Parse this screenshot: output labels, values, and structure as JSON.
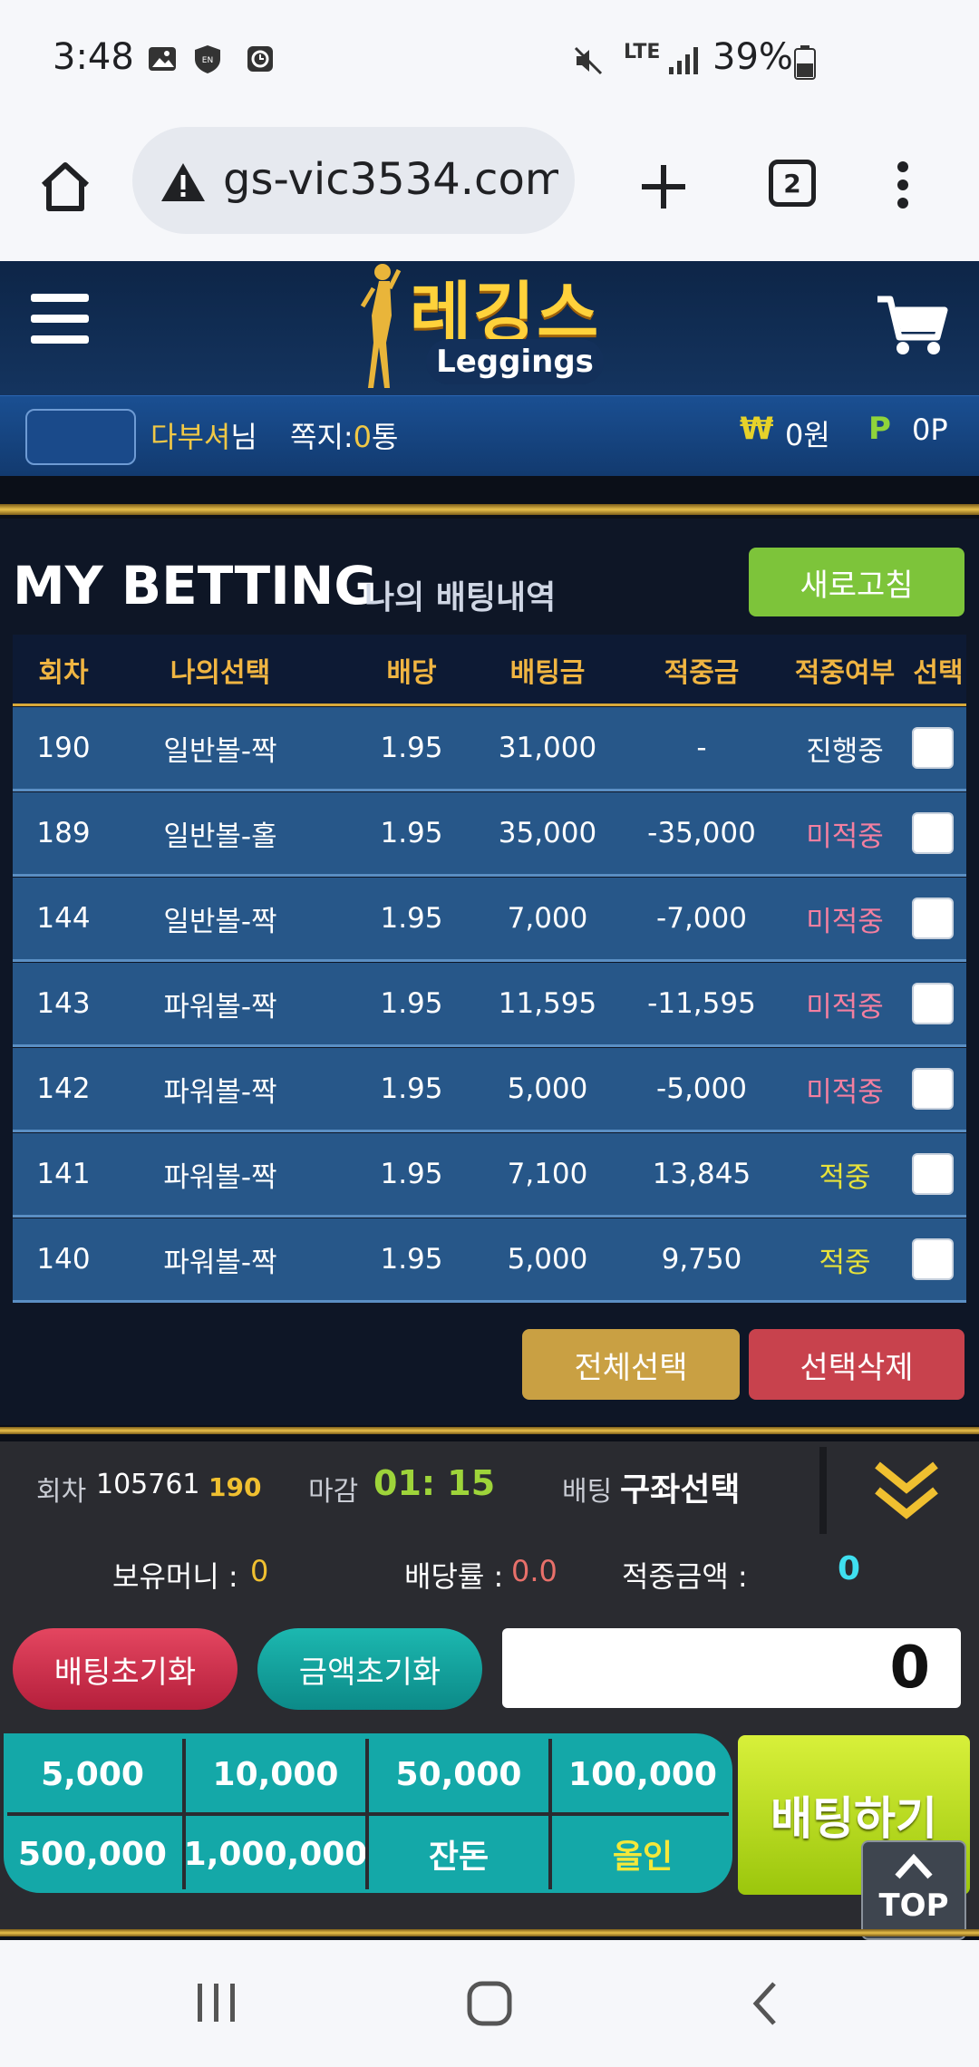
{
  "status_bar": {
    "time": "3:48",
    "network": "LTE",
    "battery": "39%"
  },
  "browser": {
    "url": "gs-vic3534.com",
    "tab_count": "2"
  },
  "site": {
    "logo_title": "레깅스",
    "logo_sub": "Leggings"
  },
  "user_bar": {
    "username": "다부셔",
    "suffix": "님",
    "messages_label": "쪽지:",
    "messages_count": "0",
    "messages_unit": "통",
    "money_symbol": "₩",
    "money": "0원",
    "points_symbol": "P",
    "points": "0P"
  },
  "betting": {
    "title": "MY BETTING",
    "subtitle": "나의 배팅내역",
    "refresh_label": "새로고침",
    "columns": [
      "회차",
      "나의선택",
      "배당",
      "배팅금",
      "적중금",
      "적중여부",
      "선택"
    ],
    "rows": [
      {
        "round": "190",
        "choice": "일반볼-짝",
        "odds": "1.95",
        "bet": "31,000",
        "win": "-",
        "result": "진행중",
        "status": "pending"
      },
      {
        "round": "189",
        "choice": "일반볼-홀",
        "odds": "1.95",
        "bet": "35,000",
        "win": "-35,000",
        "result": "미적중",
        "status": "lose"
      },
      {
        "round": "144",
        "choice": "일반볼-짝",
        "odds": "1.95",
        "bet": "7,000",
        "win": "-7,000",
        "result": "미적중",
        "status": "lose"
      },
      {
        "round": "143",
        "choice": "파워볼-짝",
        "odds": "1.95",
        "bet": "11,595",
        "win": "-11,595",
        "result": "미적중",
        "status": "lose"
      },
      {
        "round": "142",
        "choice": "파워볼-짝",
        "odds": "1.95",
        "bet": "5,000",
        "win": "-5,000",
        "result": "미적중",
        "status": "lose"
      },
      {
        "round": "141",
        "choice": "파워볼-짝",
        "odds": "1.95",
        "bet": "7,100",
        "win": "13,845",
        "result": "적중",
        "status": "win"
      },
      {
        "round": "140",
        "choice": "파워볼-짝",
        "odds": "1.95",
        "bet": "5,000",
        "win": "9,750",
        "result": "적중",
        "status": "win"
      }
    ],
    "select_all_label": "전체선택",
    "delete_label": "선택삭제"
  },
  "bet_panel": {
    "round_label": "회차",
    "round_total": "105761",
    "round_current": "190",
    "deadline_label": "마감",
    "deadline": "01: 15",
    "bet_label": "배팅",
    "bet_choice": "구좌선택",
    "money_label": "보유머니 :",
    "money_value": "0",
    "rate_label": "배당률 :",
    "rate_value": "0.0",
    "win_label": "적중금액 :",
    "win_value": "0",
    "reset_bet_label": "배팅초기화",
    "reset_amount_label": "금액초기화",
    "amount_value": "0",
    "amounts": [
      "5,000",
      "10,000",
      "50,000",
      "100,000",
      "500,000",
      "1,000,000",
      "잔돈",
      "올인"
    ],
    "bet_button": "배팅하기",
    "top_label": "TOP"
  },
  "colors": {
    "win": "#e8e23a",
    "lose": "#f47fa0",
    "pending": "#ffffff",
    "green_btn": "#7dc43a",
    "gold_btn": "#c9a043",
    "red_btn": "#c8424d",
    "teal": "#14a8a8"
  }
}
